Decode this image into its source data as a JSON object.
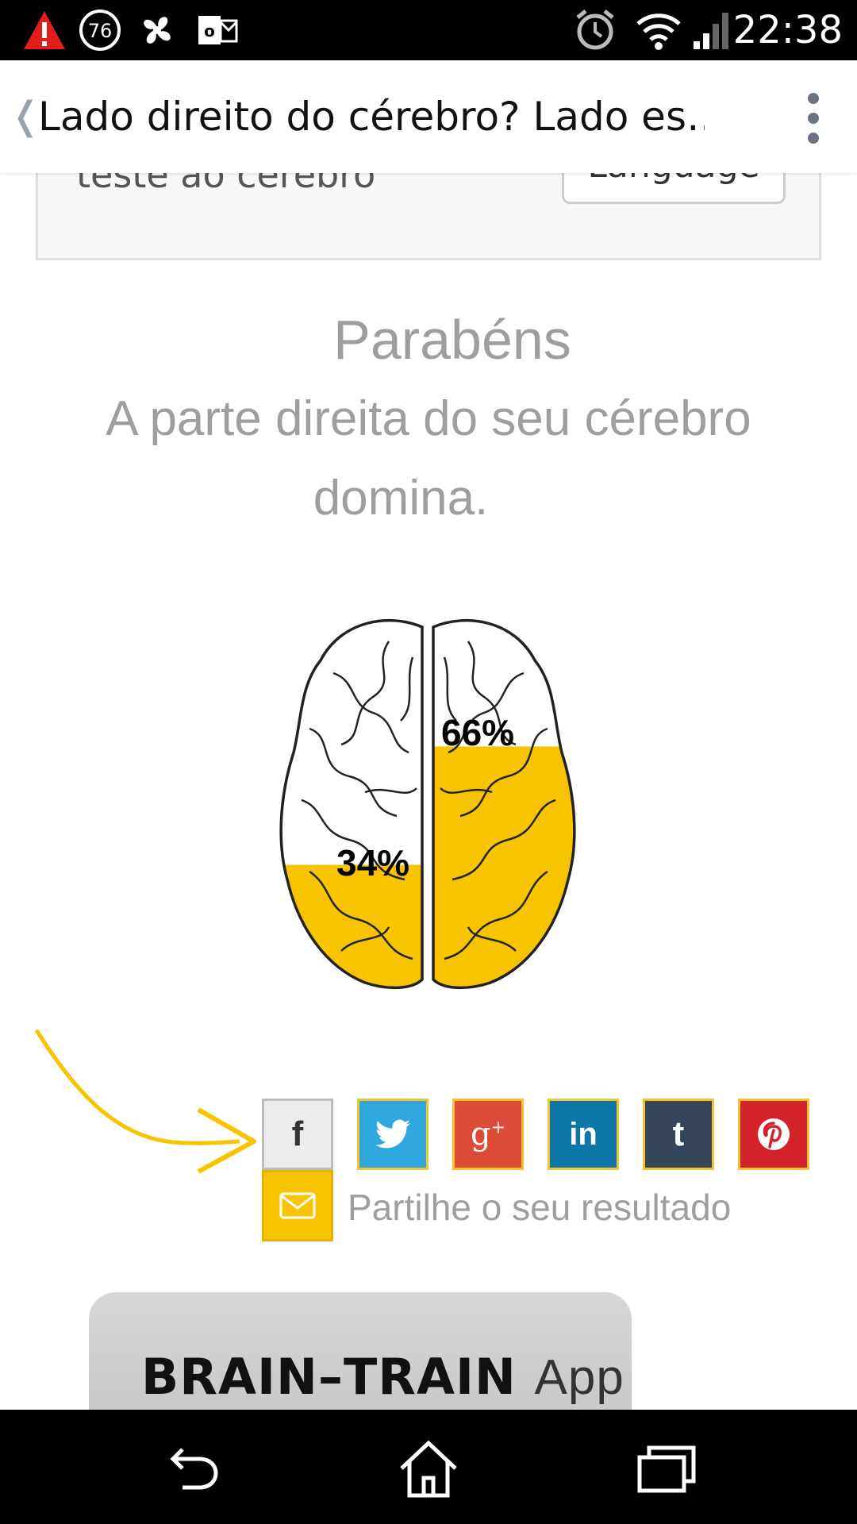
{
  "status_bar": {
    "time": "22:38",
    "badge_number": "76",
    "icons": [
      "warning-icon",
      "notification-76-icon",
      "fan-icon",
      "outlook-icon",
      "alarm-icon",
      "wifi-icon",
      "signal-icon"
    ]
  },
  "app_bar": {
    "title": "Lado direito do cérebro? Lado es…",
    "back_glyph": "❬",
    "overflow_icon": "more-vert-icon"
  },
  "top_box": {
    "clipped_text": "teste ao cérebro",
    "language_button": "Language"
  },
  "result": {
    "congrats": "Parabéns",
    "line1": "A parte direita do seu cérebro",
    "line2": "domina."
  },
  "brain": {
    "left_percent_label": "34%",
    "right_percent_label": "66%",
    "left_fill": 0.34,
    "right_fill": 0.66,
    "fill_color": "#f8c400"
  },
  "share": {
    "caption": "Partilhe o seu resultado",
    "buttons": [
      {
        "name": "facebook-share-button",
        "icon": "facebook-icon",
        "label": "f",
        "color": "#ececec"
      },
      {
        "name": "twitter-share-button",
        "icon": "twitter-icon",
        "label": "",
        "color": "#2fa8df"
      },
      {
        "name": "googleplus-share-button",
        "icon": "google-plus-icon",
        "label": "g+",
        "color": "#dd4b39"
      },
      {
        "name": "linkedin-share-button",
        "icon": "linkedin-icon",
        "label": "in",
        "color": "#0e76a8"
      },
      {
        "name": "tumblr-share-button",
        "icon": "tumblr-icon",
        "label": "t",
        "color": "#35465c"
      },
      {
        "name": "pinterest-share-button",
        "icon": "pinterest-icon",
        "label": "",
        "color": "#d3222a"
      },
      {
        "name": "email-share-button",
        "icon": "mail-icon",
        "label": "",
        "color": "#f8c400"
      }
    ]
  },
  "banner": {
    "brand": "BRAIN–TRAIN",
    "suffix": "App"
  },
  "nav_bar": {
    "icons": [
      "back-icon",
      "home-icon",
      "recents-icon"
    ]
  }
}
